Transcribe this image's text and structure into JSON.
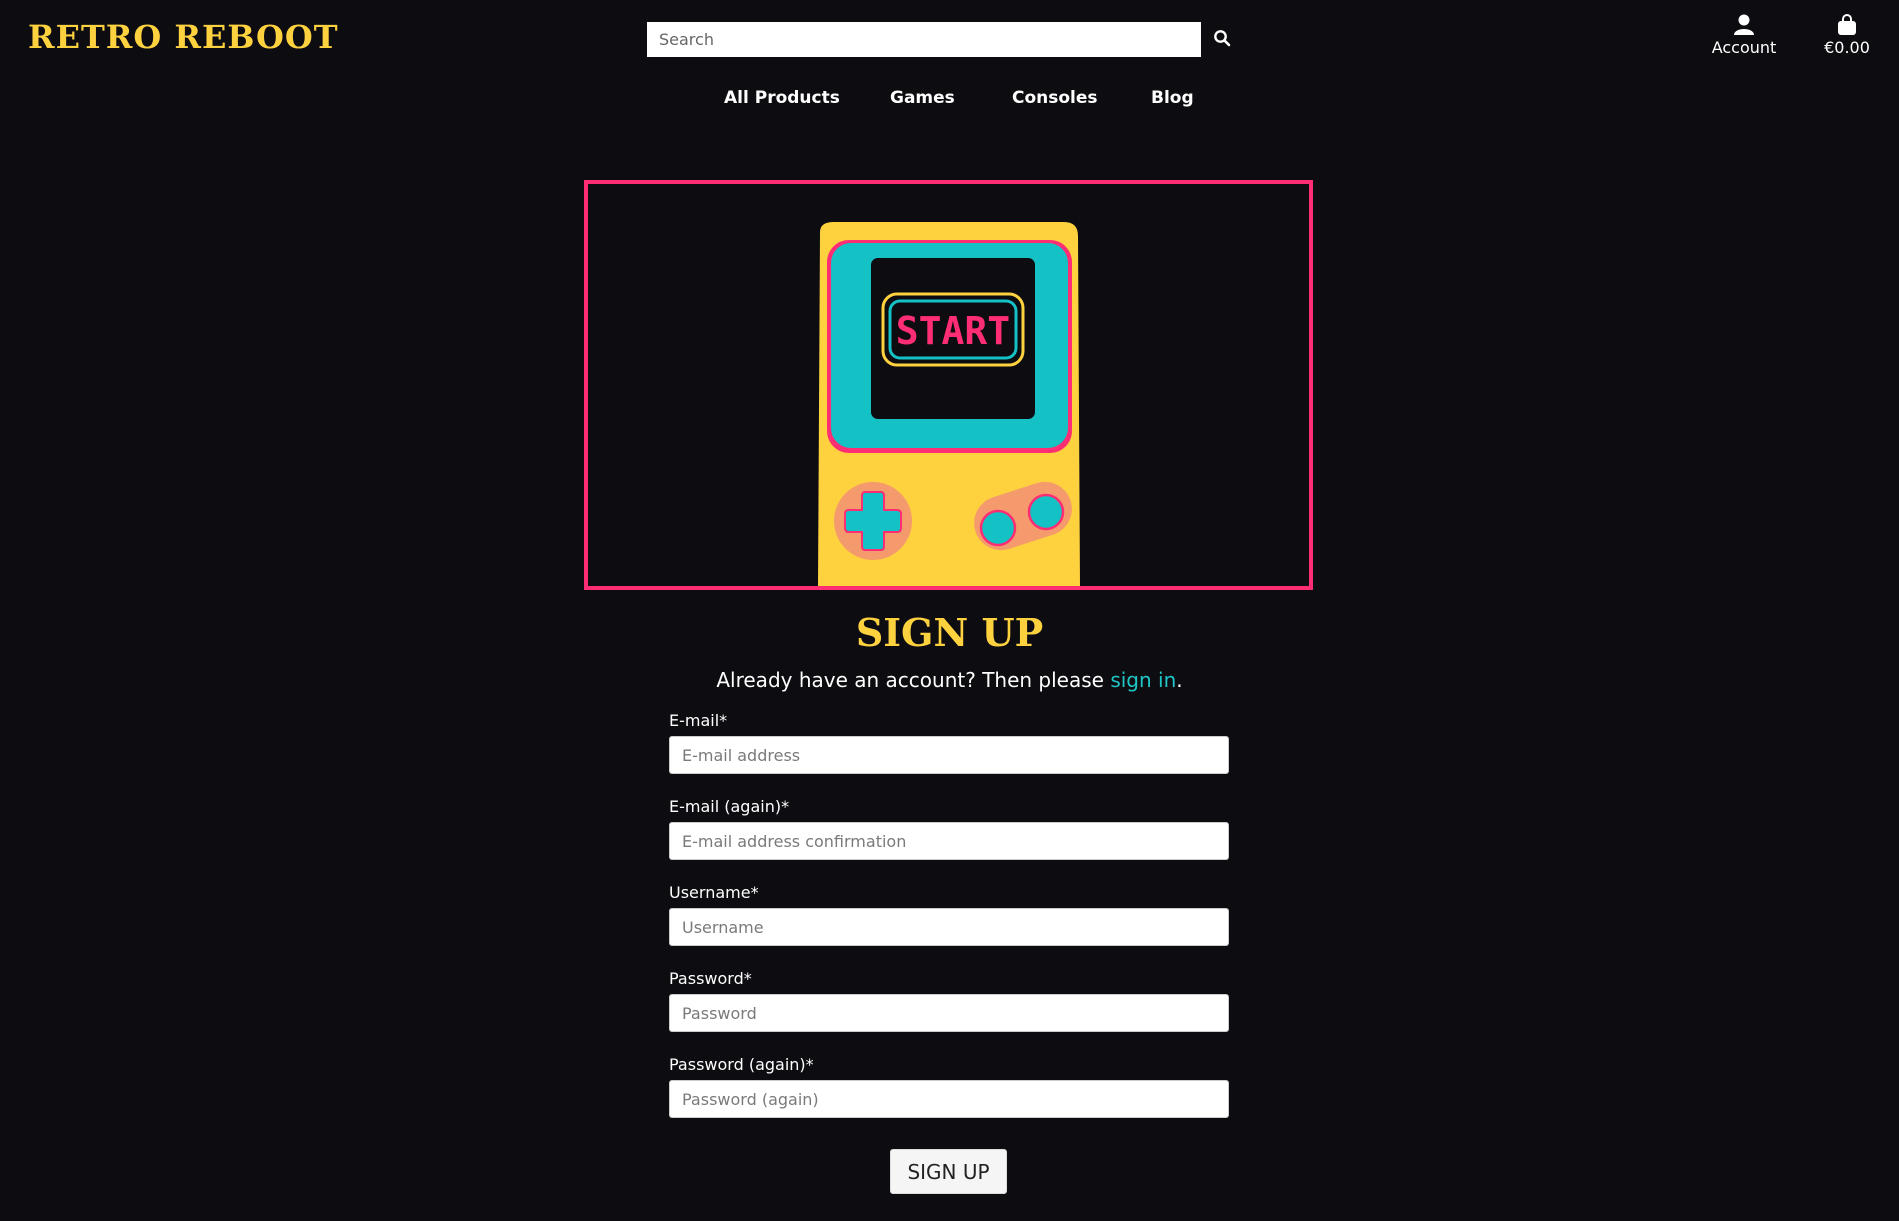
{
  "brand": {
    "logo_text": "RETRO REBOOT",
    "accent": "#fed13f",
    "link_color": "#1ec6c6",
    "frame_color": "#ff2d73"
  },
  "header": {
    "search": {
      "placeholder": "Search",
      "icon": "search-icon"
    },
    "account": {
      "label": "Account",
      "icon": "user-icon"
    },
    "cart": {
      "label": "€0.00",
      "icon": "shopping-bag-icon"
    }
  },
  "nav": {
    "items": [
      {
        "label": "All Products"
      },
      {
        "label": "Games"
      },
      {
        "label": "Consoles"
      },
      {
        "label": "Blog"
      }
    ]
  },
  "hero": {
    "screen_text": "START"
  },
  "page": {
    "title": "SIGN UP",
    "signin_prefix": "Already have an account? Then please ",
    "signin_link": "sign in",
    "signin_suffix": "."
  },
  "form": {
    "fields": [
      {
        "label": "E-mail*",
        "placeholder": "E-mail address"
      },
      {
        "label": "E-mail (again)*",
        "placeholder": "E-mail address confirmation"
      },
      {
        "label": "Username*",
        "placeholder": "Username"
      },
      {
        "label": "Password*",
        "placeholder": "Password"
      },
      {
        "label": "Password (again)*",
        "placeholder": "Password (again)"
      }
    ],
    "submit_label": "SIGN UP"
  }
}
